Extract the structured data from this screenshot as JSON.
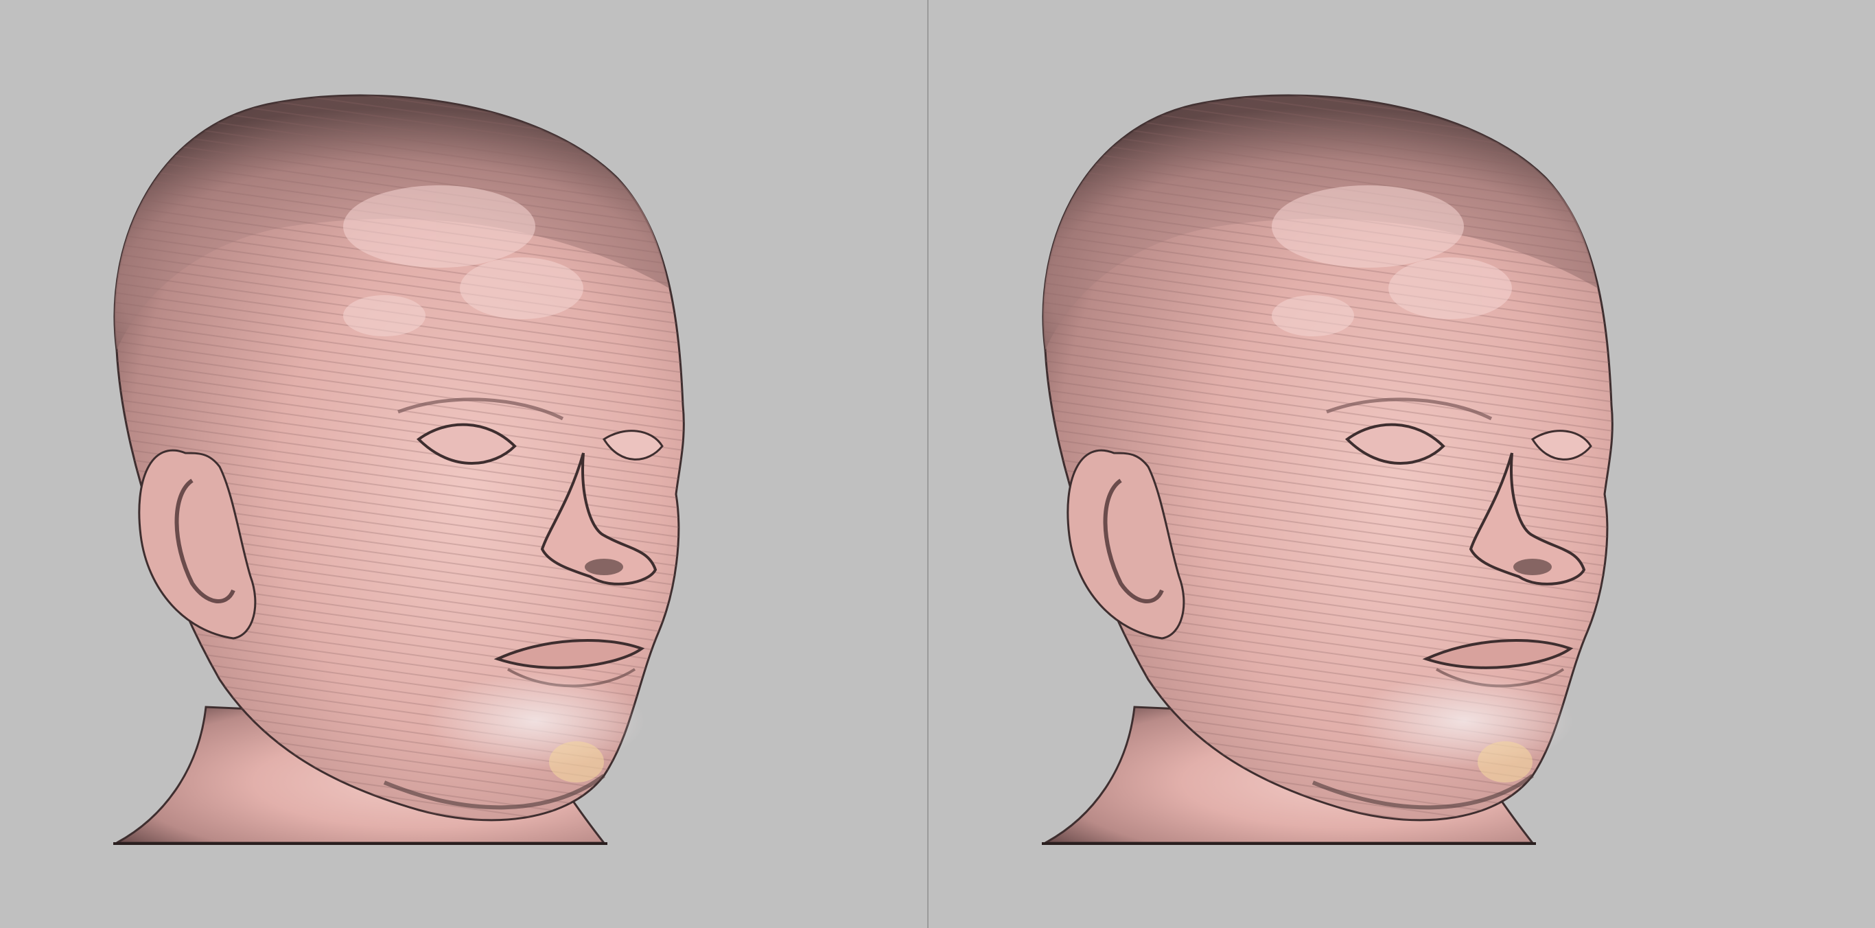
{
  "app": {
    "layout": "dual-viewport",
    "colors": {
      "background": "#c0c0c0",
      "divider": "#9a9a9a",
      "skin": "#e4b2ad",
      "skin_shadow": "#8c6462",
      "skin_highlight": "#f3d2cf",
      "outline": "#3e2e2f"
    }
  },
  "viewports": [
    {
      "id": "left",
      "content": "3d-head-render"
    },
    {
      "id": "right",
      "content": "3d-head-render"
    }
  ]
}
